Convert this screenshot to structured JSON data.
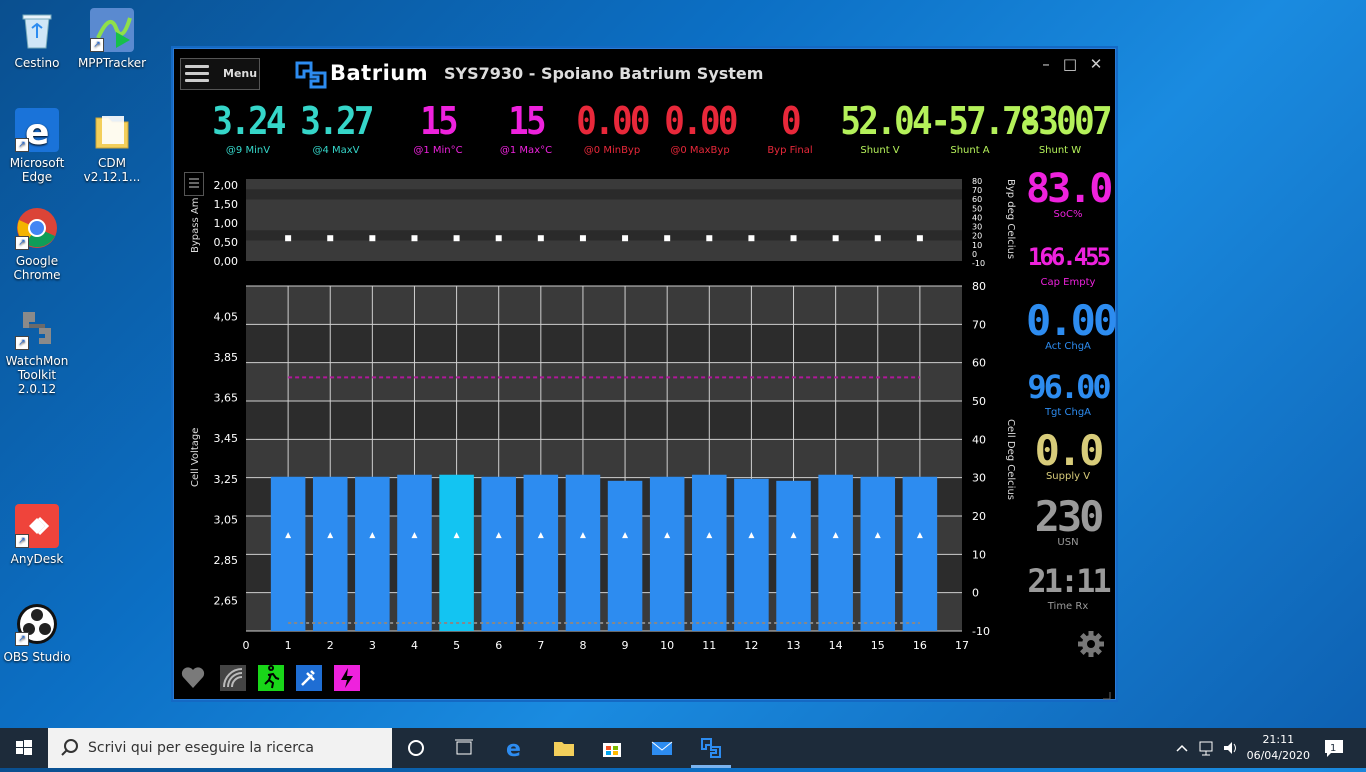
{
  "desktop": {
    "icons": [
      {
        "label": "Cestino"
      },
      {
        "label": "MPPTracker"
      },
      {
        "label": "Microsoft Edge"
      },
      {
        "label": "CDM v2.12.1..."
      },
      {
        "label": "Google Chrome"
      },
      {
        "label": "WatchMon Toolkit 2.0.12"
      },
      {
        "label": "AnyDesk"
      },
      {
        "label": "OBS Studio"
      }
    ]
  },
  "window": {
    "menu_label": "Menu",
    "logo_text": "Batrium",
    "title": "SYS7930 - Spoiano  Batrium System",
    "controls": {
      "minimize": "–",
      "maximize": "□",
      "close": "✕"
    }
  },
  "top_metrics": [
    {
      "value": "3.24",
      "label": "@9 MinV",
      "color": "#35d6c9"
    },
    {
      "value": "3.27",
      "label": "@4 MaxV",
      "color": "#35d6c9"
    },
    {
      "value": "15",
      "label": "@1 Min°C",
      "color": "#ee22dd"
    },
    {
      "value": "15",
      "label": "@1 Max°C",
      "color": "#ee22dd"
    },
    {
      "value": "0.00",
      "label": "@0 MinByp",
      "color": "#e8283a"
    },
    {
      "value": "0.00",
      "label": "@0 MaxByp",
      "color": "#e8283a"
    },
    {
      "value": "0",
      "label": "Byp Final",
      "color": "#e8283a"
    },
    {
      "value": "52.04",
      "label": "Shunt V",
      "color": "#b4f15a"
    },
    {
      "value": "-57.78",
      "label": "Shunt A",
      "color": "#b4f15a"
    },
    {
      "value": "-3007",
      "label": "Shunt W",
      "color": "#b4f15a"
    }
  ],
  "side_metrics": [
    {
      "value": "83.0",
      "label": "SoC%",
      "color": "#ee22dd"
    },
    {
      "value": "166.455",
      "label": "Cap Empty",
      "color": "#ee22dd"
    },
    {
      "value": "0.00",
      "label": "Act ChgA",
      "color": "#2d8cf0"
    },
    {
      "value": "96.00",
      "label": "Tgt ChgA",
      "color": "#2d8cf0"
    },
    {
      "value": "0.0",
      "label": "Supply V",
      "color": "#d8cc7a"
    },
    {
      "value": "230",
      "label": "USN",
      "color": "#9a9a9a"
    },
    {
      "value": "21:11",
      "label": "Time Rx",
      "color": "#9a9a9a"
    }
  ],
  "chart_data": [
    {
      "type": "scatter",
      "ylabel": "Bypass Am",
      "y2label": "Byp deg Celcius",
      "y_ticks": [
        "2,00",
        "1,50",
        "1,00",
        "0,50",
        "0,00"
      ],
      "ylim": [
        0,
        2
      ],
      "y2_ticks": [
        "80",
        "70",
        "60",
        "50",
        "40",
        "30",
        "20",
        "10",
        "0",
        "-10"
      ],
      "x": [
        1,
        2,
        3,
        4,
        5,
        6,
        7,
        8,
        9,
        10,
        11,
        12,
        13,
        14,
        15,
        16
      ],
      "values": [
        0,
        0,
        0,
        0,
        0,
        0,
        0,
        0,
        0,
        0,
        0,
        0,
        0,
        0,
        0,
        0
      ],
      "temp_values": [
        15,
        15,
        15,
        15,
        15,
        15,
        15,
        15,
        15,
        15,
        15,
        15,
        15,
        15,
        15,
        15
      ]
    },
    {
      "type": "bar",
      "ylabel": "Cell Voltage",
      "y2label": "Cell Deg Celcius",
      "y_ticks": [
        "4,05",
        "3,85",
        "3,65",
        "3,45",
        "3,25",
        "3,05",
        "2,85",
        "2,65"
      ],
      "ylim": [
        2.5,
        4.2
      ],
      "y2lim": [
        -10,
        80
      ],
      "y2_ticks": [
        "80",
        "70",
        "60",
        "50",
        "40",
        "30",
        "20",
        "10",
        "0",
        "-10"
      ],
      "x_ticks": [
        "0",
        "1",
        "2",
        "3",
        "4",
        "5",
        "6",
        "7",
        "8",
        "9",
        "10",
        "11",
        "12",
        "13",
        "14",
        "15",
        "16",
        "17"
      ],
      "categories": [
        "1",
        "2",
        "3",
        "4",
        "5",
        "6",
        "7",
        "8",
        "9",
        "10",
        "11",
        "12",
        "13",
        "14",
        "15",
        "16"
      ],
      "values": [
        3.26,
        3.26,
        3.26,
        3.27,
        3.27,
        3.26,
        3.27,
        3.27,
        3.24,
        3.26,
        3.27,
        3.25,
        3.24,
        3.27,
        3.26,
        3.26
      ],
      "highlight_index": 4,
      "bar_color": "#2d8cf0",
      "highlight_color": "#13c4f2",
      "marker_temp": 15,
      "limit_line_v": 3.75
    }
  ],
  "taskbar": {
    "search_placeholder": "Scrivi qui per eseguire la ricerca",
    "time": "21:11",
    "date": "06/04/2020",
    "notification_count": "1"
  }
}
